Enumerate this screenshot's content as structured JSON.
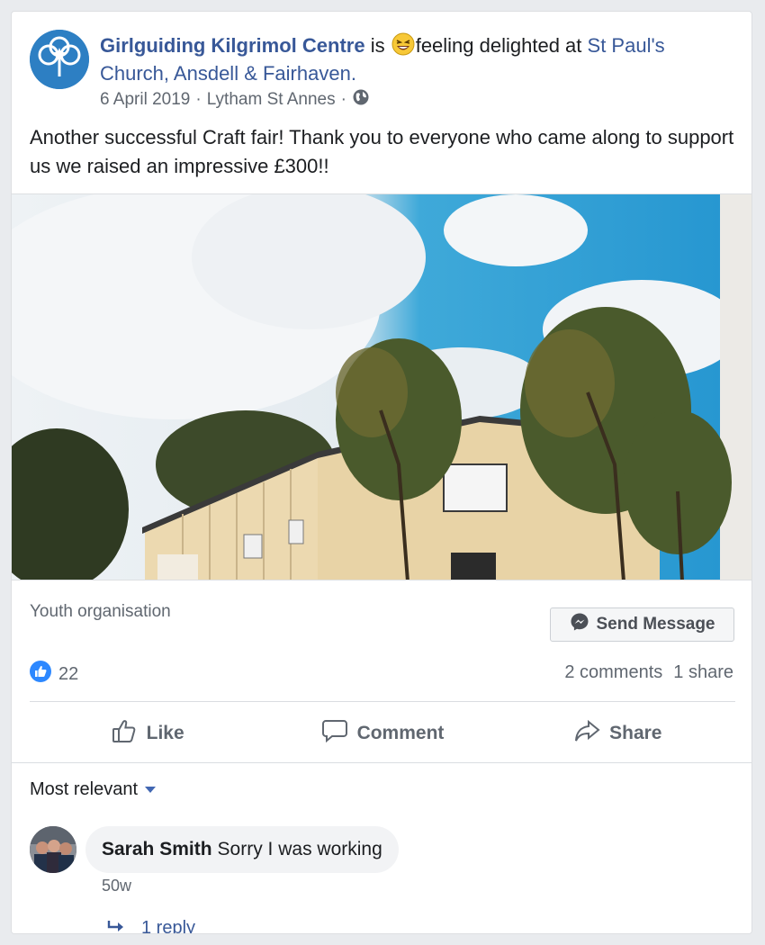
{
  "post": {
    "author": "Girlguiding Kilgrimol Centre",
    "is_text": "is",
    "feeling_text": "feeling delighted at",
    "place": "St Paul's Church, Ansdell & Fairhaven.",
    "date": "6 April 2019",
    "sep1": "·",
    "location": "Lytham St Annes",
    "sep2": "·",
    "body": "Another successful Craft fair! Thank you to everyone who came along to support us we raised an impressive £300!!",
    "icons": {
      "avatar": "trefoil-logo-icon",
      "feeling": "laughing-emoji-icon",
      "privacy": "globe-icon"
    }
  },
  "page_info": {
    "category": "Youth organisation",
    "send_message_label": "Send Message"
  },
  "engagement": {
    "likes": "22",
    "comments": "2 comments",
    "shares": "1 share"
  },
  "actions": {
    "like": "Like",
    "comment": "Comment",
    "share": "Share"
  },
  "comments": {
    "sort_label": "Most relevant",
    "items": [
      {
        "author": "Sarah Smith",
        "text": "Sorry I was working",
        "time": "50w",
        "replies_label": "1 reply"
      }
    ]
  },
  "colors": {
    "link": "#385898",
    "accent": "#4267b2",
    "muted": "#606770"
  }
}
